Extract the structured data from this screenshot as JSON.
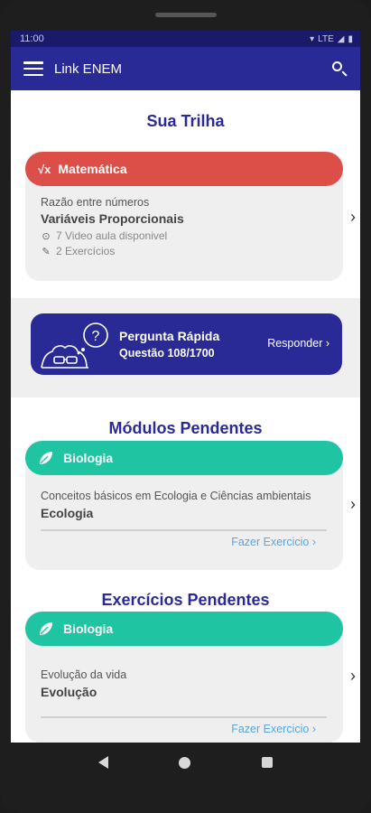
{
  "status": {
    "time": "11:00",
    "signal_label": "LTE"
  },
  "appbar": {
    "title": "Link ENEM"
  },
  "trail": {
    "title": "Sua Trilha",
    "card": {
      "subject": "Matemática",
      "subject_icon": "sqrt-icon",
      "subtitle": "Razão entre números",
      "topic": "Variáveis Proporcionais",
      "videos": "7 Video aula disponivel",
      "exercises": "2 Exercícios"
    }
  },
  "quick_question": {
    "title": "Pergunta Rápida",
    "progress": "Questão 108/1700",
    "button": "Responder ›"
  },
  "pending_modules": {
    "title": "Módulos Pendentes",
    "card": {
      "subject": "Biologia",
      "subtitle": "Conceitos básicos em Ecologia e Ciências ambientais",
      "topic": "Ecologia",
      "action": "Fazer Exercicio ›"
    }
  },
  "pending_exercises": {
    "title": "Exercícios Pendentes",
    "card": {
      "subject": "Biologia",
      "subtitle": "Evolução da vida",
      "topic": "Evolução",
      "action": "Fazer Exercicio ›"
    }
  },
  "colors": {
    "primary": "#2a2a96",
    "math": "#dc4f48",
    "biology": "#1fc4a2",
    "link": "#56a6e8"
  }
}
